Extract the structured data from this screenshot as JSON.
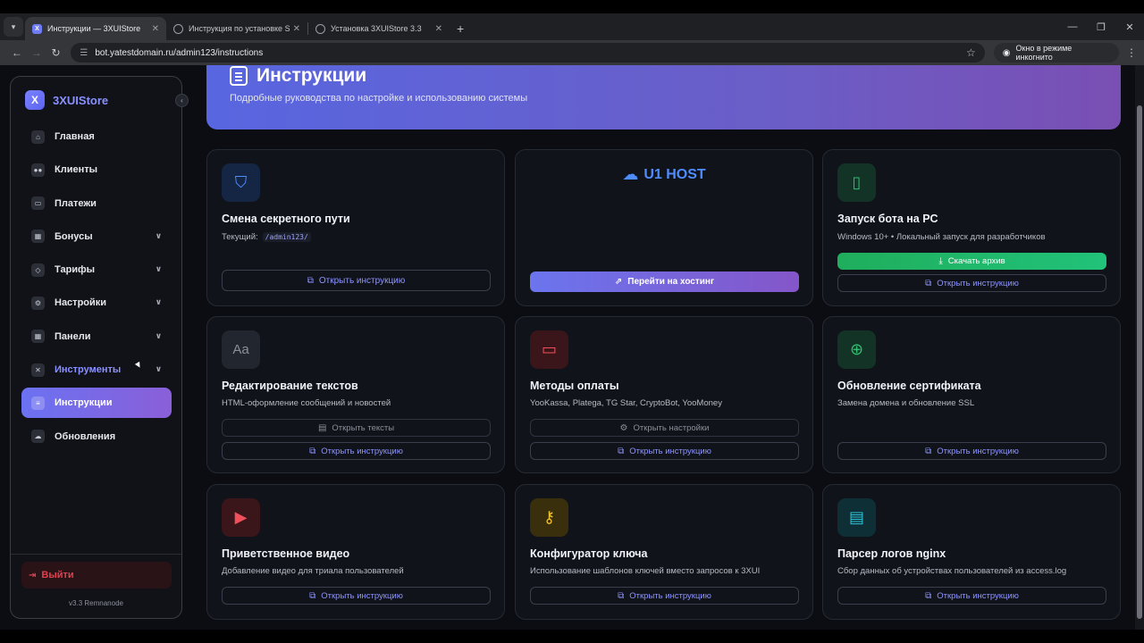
{
  "browser": {
    "tabs": [
      {
        "title": "Инструкции — 3XUIStore",
        "favicon": "x"
      },
      {
        "title": "Инструкция по установке SUI",
        "favicon": "globe"
      },
      {
        "title": "Установка 3XUIStore 3.3",
        "favicon": "globe"
      }
    ],
    "url": "bot.yatestdomain.ru/admin123/instructions",
    "incognito_label": "Окно в режиме инкогнито"
  },
  "sidebar": {
    "brand_logo": "X",
    "brand_name": "3XUIStore",
    "items": [
      {
        "label": "Главная",
        "icon": "home-icon",
        "chevron": false
      },
      {
        "label": "Клиенты",
        "icon": "users-icon",
        "chevron": false
      },
      {
        "label": "Платежи",
        "icon": "card-icon",
        "chevron": false
      },
      {
        "label": "Бонусы",
        "icon": "gift-icon",
        "chevron": true
      },
      {
        "label": "Тарифы",
        "icon": "tag-icon",
        "chevron": true
      },
      {
        "label": "Настройки",
        "icon": "gear-icon",
        "chevron": true
      },
      {
        "label": "Панели",
        "icon": "grid-icon",
        "chevron": true
      },
      {
        "label": "Инструменты",
        "icon": "tools-icon",
        "chevron": true
      },
      {
        "label": "Инструкции",
        "icon": "doc-icon",
        "chevron": false
      },
      {
        "label": "Обновления",
        "icon": "cloud-icon",
        "chevron": false
      }
    ],
    "logout": "Выйти",
    "version": "v3.3 Remnanode"
  },
  "header": {
    "title": "Инструкции",
    "subtitle": "Подробные руководства по настройке и использованию системы"
  },
  "cards": {
    "secret_path": {
      "title": "Смена секретного пути",
      "desc_prefix": "Текущий:",
      "code": "/admin123/",
      "button": "Открыть инструкцию"
    },
    "hosting": {
      "brand": "U1 HOST",
      "button": "Перейти на хостинг"
    },
    "pc_bot": {
      "title": "Запуск бота на PC",
      "desc": "Windows 10+ • Локальный запуск для разработчиков",
      "button_primary": "Скачать архив",
      "button": "Открыть инструкцию"
    },
    "texts": {
      "title": "Редактирование текстов",
      "desc": "HTML-оформление сообщений и новостей",
      "icon_text": "Aa",
      "button_secondary": "Открыть тексты",
      "button": "Открыть инструкцию"
    },
    "payments": {
      "title": "Методы оплаты",
      "desc": "YooKassa, Platega, TG Star, CryptoBot, YooMoney",
      "button_secondary": "Открыть настройки",
      "button": "Открыть инструкцию"
    },
    "certificate": {
      "title": "Обновление сертификата",
      "desc": "Замена домена и обновление SSL",
      "button": "Открыть инструкцию"
    },
    "video": {
      "title": "Приветственное видео",
      "desc": "Добавление видео для триала пользователей",
      "button": "Открыть инструкцию"
    },
    "key_config": {
      "title": "Конфигуратор ключа",
      "desc": "Использование шаблонов ключей вместо запросов к 3XUI",
      "button": "Открыть инструкцию"
    },
    "nginx": {
      "title": "Парсер логов nginx",
      "desc": "Сбор данных об устройствах пользователей из access.log",
      "button": "Открыть инструкцию"
    }
  },
  "colors": {
    "accent": "#6b72f2",
    "accent2": "#8a5fd8",
    "danger": "#e0404f",
    "success": "#21c27a"
  }
}
